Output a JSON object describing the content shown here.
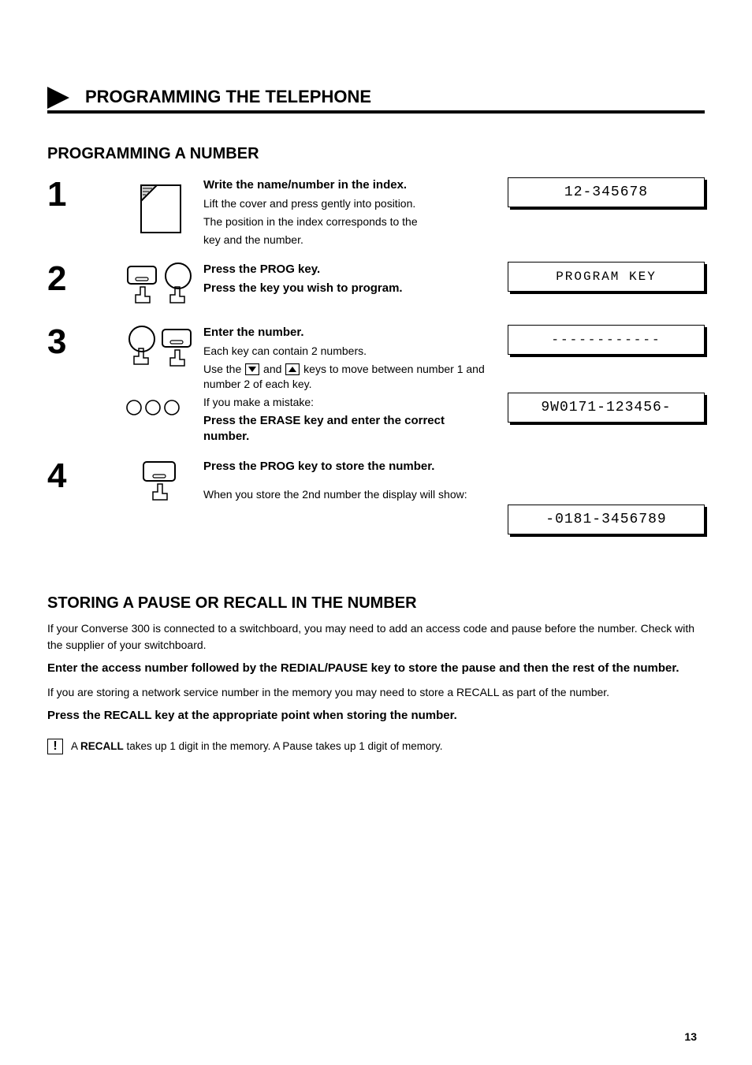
{
  "header": {
    "title": "PROGRAMMING THE TELEPHONE"
  },
  "section_title": "PROGRAMMING A NUMBER",
  "steps": [
    {
      "num": "1",
      "lines": [
        "Write the name/number in the index.",
        "Lift the cover and press gently into position.",
        "The position in the index corresponds to the",
        "key and the number."
      ],
      "display": "12-345678"
    },
    {
      "num": "2",
      "lines": [
        {
          "b": "Press the PROG key."
        },
        {
          "b": "Press the key you wish to program."
        }
      ],
      "displays": [
        "PROGRAM KEY",
        "------------"
      ]
    },
    {
      "num": "3",
      "lines": [
        {
          "b": "Enter the number."
        },
        {
          "p": "Each key can contain 2 numbers.",
          "style": "plain"
        },
        {
          "p": "Use the {down} and {up} keys to move between number 1 and number 2 of each key.",
          "style": "plain"
        },
        {
          "p": "If you make a mistake:",
          "style": "plain"
        },
        {
          "b": "Press the ERASE key and enter the correct number."
        }
      ],
      "display": "9W0171-123456-"
    },
    {
      "num": "4",
      "lines": [
        {
          "b": "Press the PROG key to store the number."
        }
      ],
      "sublabel": "When you store the 2nd number the display will show:",
      "display": "-0181-3456789"
    }
  ],
  "sub_section": {
    "title": "STORING A PAUSE OR RECALL IN THE NUMBER",
    "paras": [
      {
        "p": "If your Converse 300 is connected to a switchboard, you may need to add an access code and pause before the number. Check with the supplier of your switchboard."
      },
      {
        "b": "Enter the access number followed by the REDIAL/PAUSE key to store the pause and then the rest of the number."
      },
      {
        "p": "If you are storing a network service number in the memory you may need to store a RECALL as part of the number."
      },
      {
        "b": "Press the RECALL key at the appropriate point when storing the number."
      }
    ],
    "note": {
      "lead": "A",
      "body_bold": "RECALL",
      "body_rest": " takes up 1 digit in the memory. A Pause takes up 1 digit of memory."
    }
  },
  "page_number": "13"
}
